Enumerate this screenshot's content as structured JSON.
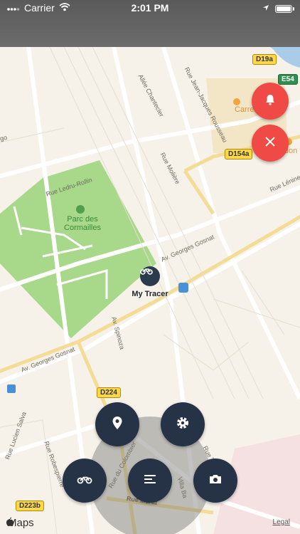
{
  "status_bar": {
    "carrier": "Carrier",
    "time": "2:01 PM"
  },
  "map": {
    "park": {
      "name": "Parc des Cormailles"
    },
    "tracer": {
      "label": "My Tracer"
    },
    "poi": [
      {
        "label": "Carrel"
      },
      {
        "label": "ction"
      }
    ],
    "road_labels": [
      {
        "text": "Rue Jean-Jacques Rousseau"
      },
      {
        "text": "Allée Chantecler"
      },
      {
        "text": "Rue Molière"
      },
      {
        "text": "Rue Ledru-Rollin"
      },
      {
        "text": "Av. Georges Gosnat"
      },
      {
        "text": "Av. Georges Gosnat"
      },
      {
        "text": "Av. Spinoza"
      },
      {
        "text": "Rue Lénine"
      },
      {
        "text": "Rue Lucien Salva"
      },
      {
        "text": "Rue Robespierre"
      },
      {
        "text": "Rue du Colombier"
      },
      {
        "text": "Rue Marat"
      },
      {
        "text": "Villa Ba"
      },
      {
        "text": "Rue Truil"
      },
      {
        "text": "go"
      }
    ],
    "shields": [
      {
        "text": "D19a",
        "style": "yellow"
      },
      {
        "text": "E54",
        "style": "green"
      },
      {
        "text": "D154a",
        "style": "yellow"
      },
      {
        "text": "D224",
        "style": "yellow"
      },
      {
        "text": "D223b",
        "style": "yellow"
      }
    ],
    "attribution": "Maps",
    "legal": "Legal"
  },
  "colors": {
    "alert_red": "#f04a47",
    "fab_dark": "#263245",
    "park_green": "#a8d88a"
  },
  "icons": {
    "alarm": "bell-icon",
    "stop": "close-icon",
    "locate": "location-pin-icon",
    "settings": "gear-icon",
    "vehicle": "motorcycle-icon",
    "menu": "menu-icon",
    "camera": "camera-icon"
  }
}
